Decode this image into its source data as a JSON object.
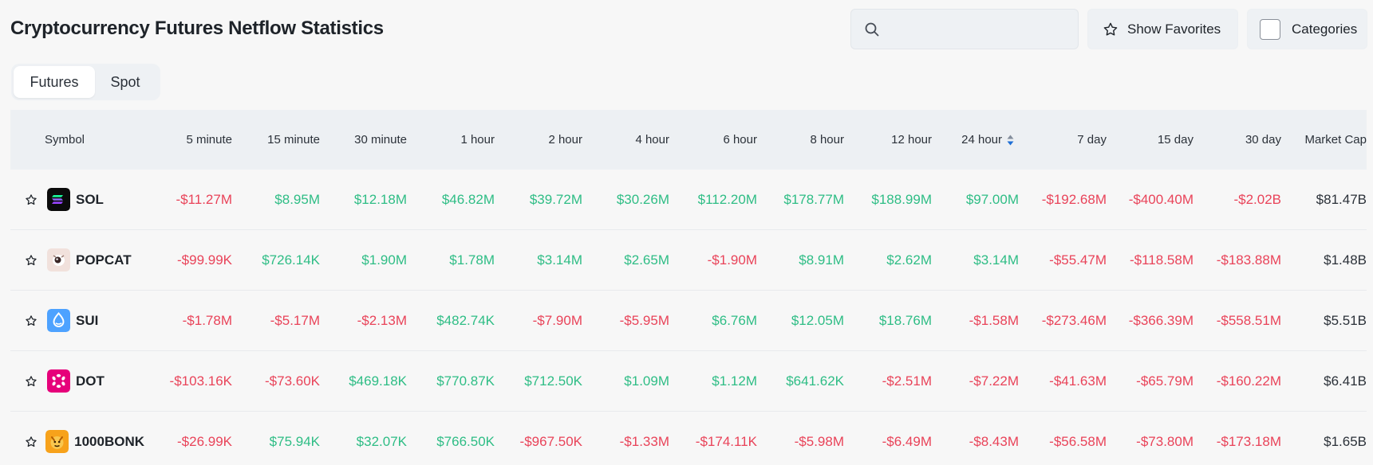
{
  "page": {
    "title": "Cryptocurrency Futures Netflow Statistics"
  },
  "search": {
    "value": "",
    "placeholder": ""
  },
  "toolbar": {
    "favorites_label": "Show Favorites",
    "categories_label": "Categories"
  },
  "tabs": [
    {
      "label": "Futures",
      "active": true
    },
    {
      "label": "Spot",
      "active": false
    }
  ],
  "colors": {
    "positive": "#2ebd85",
    "negative": "#e94359",
    "sort_active": "#1f6fd6"
  },
  "table": {
    "columns": [
      "Symbol",
      "5 minute",
      "15 minute",
      "30 minute",
      "1 hour",
      "2 hour",
      "4 hour",
      "6 hour",
      "8 hour",
      "12 hour",
      "24 hour",
      "7 day",
      "15 day",
      "30 day",
      "Market Cap"
    ],
    "sorted_column": "24 hour",
    "rows": [
      {
        "symbol": "SOL",
        "icon": "sol-coin-icon",
        "values": [
          "-$11.27M",
          "$8.95M",
          "$12.18M",
          "$46.82M",
          "$39.72M",
          "$30.26M",
          "$112.20M",
          "$178.77M",
          "$188.99M",
          "$97.00M",
          "-$192.68M",
          "-$400.40M",
          "-$2.02B"
        ],
        "market_cap": "$81.47B"
      },
      {
        "symbol": "POPCAT",
        "icon": "popcat-coin-icon",
        "values": [
          "-$99.99K",
          "$726.14K",
          "$1.90M",
          "$1.78M",
          "$3.14M",
          "$2.65M",
          "-$1.90M",
          "$8.91M",
          "$2.62M",
          "$3.14M",
          "-$55.47M",
          "-$118.58M",
          "-$183.88M"
        ],
        "market_cap": "$1.48B"
      },
      {
        "symbol": "SUI",
        "icon": "sui-coin-icon",
        "values": [
          "-$1.78M",
          "-$5.17M",
          "-$2.13M",
          "$482.74K",
          "-$7.90M",
          "-$5.95M",
          "$6.76M",
          "$12.05M",
          "$18.76M",
          "-$1.58M",
          "-$273.46M",
          "-$366.39M",
          "-$558.51M"
        ],
        "market_cap": "$5.51B"
      },
      {
        "symbol": "DOT",
        "icon": "dot-coin-icon",
        "values": [
          "-$103.16K",
          "-$73.60K",
          "$469.18K",
          "$770.87K",
          "$712.50K",
          "$1.09M",
          "$1.12M",
          "$641.62K",
          "-$2.51M",
          "-$7.22M",
          "-$41.63M",
          "-$65.79M",
          "-$160.22M"
        ],
        "market_cap": "$6.41B"
      },
      {
        "symbol": "1000BONK",
        "icon": "bonk-coin-icon",
        "values": [
          "-$26.99K",
          "$75.94K",
          "$32.07K",
          "$766.50K",
          "-$967.50K",
          "-$1.33M",
          "-$174.11K",
          "-$5.98M",
          "-$6.49M",
          "-$8.43M",
          "-$56.58M",
          "-$73.80M",
          "-$173.18M"
        ],
        "market_cap": "$1.65B"
      }
    ]
  }
}
